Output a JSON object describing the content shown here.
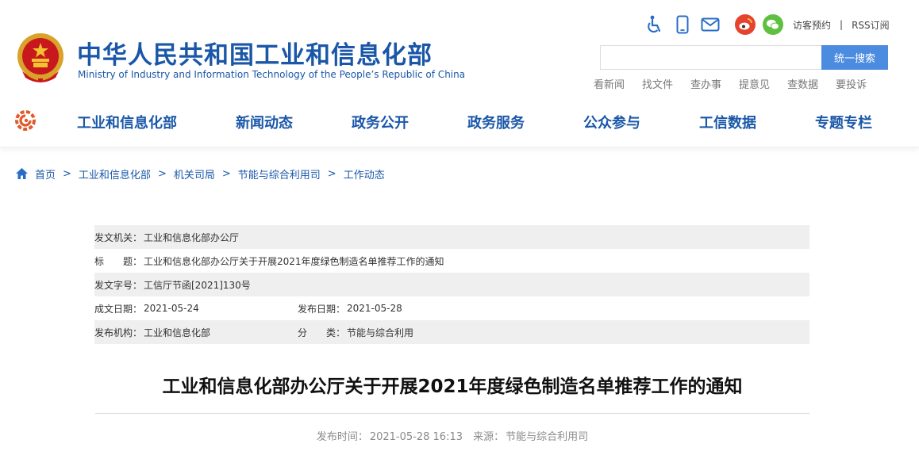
{
  "header": {
    "title_cn": "中华人民共和国工业和信息化部",
    "title_en": "Ministry of Industry and Information Technology of the People’s Republic of China",
    "icons": [
      "accessibility-icon",
      "mobile-icon",
      "mail-icon",
      "weibo-icon",
      "wechat-icon"
    ],
    "visitor_booking": "访客预约",
    "separator": "|",
    "rss": "RSS订阅",
    "search": {
      "value": "",
      "placeholder": "",
      "button": "统一搜索"
    },
    "quick_links": [
      "看新闻",
      "找文件",
      "查办事",
      "提意见",
      "查数据",
      "要投诉"
    ]
  },
  "nav": {
    "items": [
      "工业和信息化部",
      "新闻动态",
      "政务公开",
      "政务服务",
      "公众参与",
      "工信数据",
      "专题专栏"
    ]
  },
  "breadcrumb": {
    "items": [
      "首页",
      "工业和信息化部",
      "机关司局",
      "节能与综合利用司",
      "工作动态"
    ],
    "separator": ">"
  },
  "meta": {
    "issuer_label": "发文机关：",
    "issuer": "工业和信息化部办公厅",
    "title_label": "标　　题：",
    "title": "工业和信息化部办公厅关于开展2021年度绿色制造名单推荐工作的通知",
    "doc_no_label": "发文字号：",
    "doc_no": "工信厅节函[2021]130号",
    "created_label": "成文日期：",
    "created": "2021-05-24",
    "published_label": "发布日期：",
    "published": "2021-05-28",
    "org_label": "发布机构：",
    "org": "工业和信息化部",
    "category_label": "分　　类：",
    "category": "节能与综合利用"
  },
  "article": {
    "title": "工业和信息化部办公厅关于开展2021年度绿色制造名单推荐工作的通知",
    "time_label": "发布时间：",
    "time": "2021-05-28 16:13",
    "source_label": "来源：",
    "source": "节能与综合利用司"
  },
  "colors": {
    "brand_blue": "#1a57a8",
    "search_button": "#4c8ce0",
    "meta_shade": "#efefef",
    "weibo": "#e6432f",
    "wechat": "#5fbf3f"
  }
}
